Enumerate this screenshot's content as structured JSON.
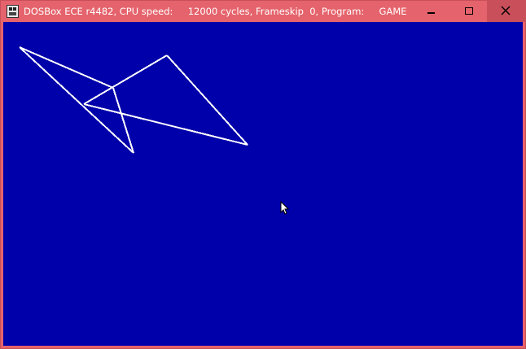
{
  "window": {
    "title": "DOSBox ECE r4482, CPU speed:     12000 cycles, Frameskip  0, Program:     GAME",
    "icon": "dosbox-app-icon",
    "controls": {
      "minimize": "minimize-icon",
      "maximize": "maximize-icon",
      "close": "close-icon"
    },
    "colors": {
      "titlebar": "#e5636c",
      "close_button": "#c9505a"
    }
  },
  "screen": {
    "background": "#0000aa",
    "line_color": "#ffffff",
    "cursor_icon": "mouse-pointer-icon"
  }
}
